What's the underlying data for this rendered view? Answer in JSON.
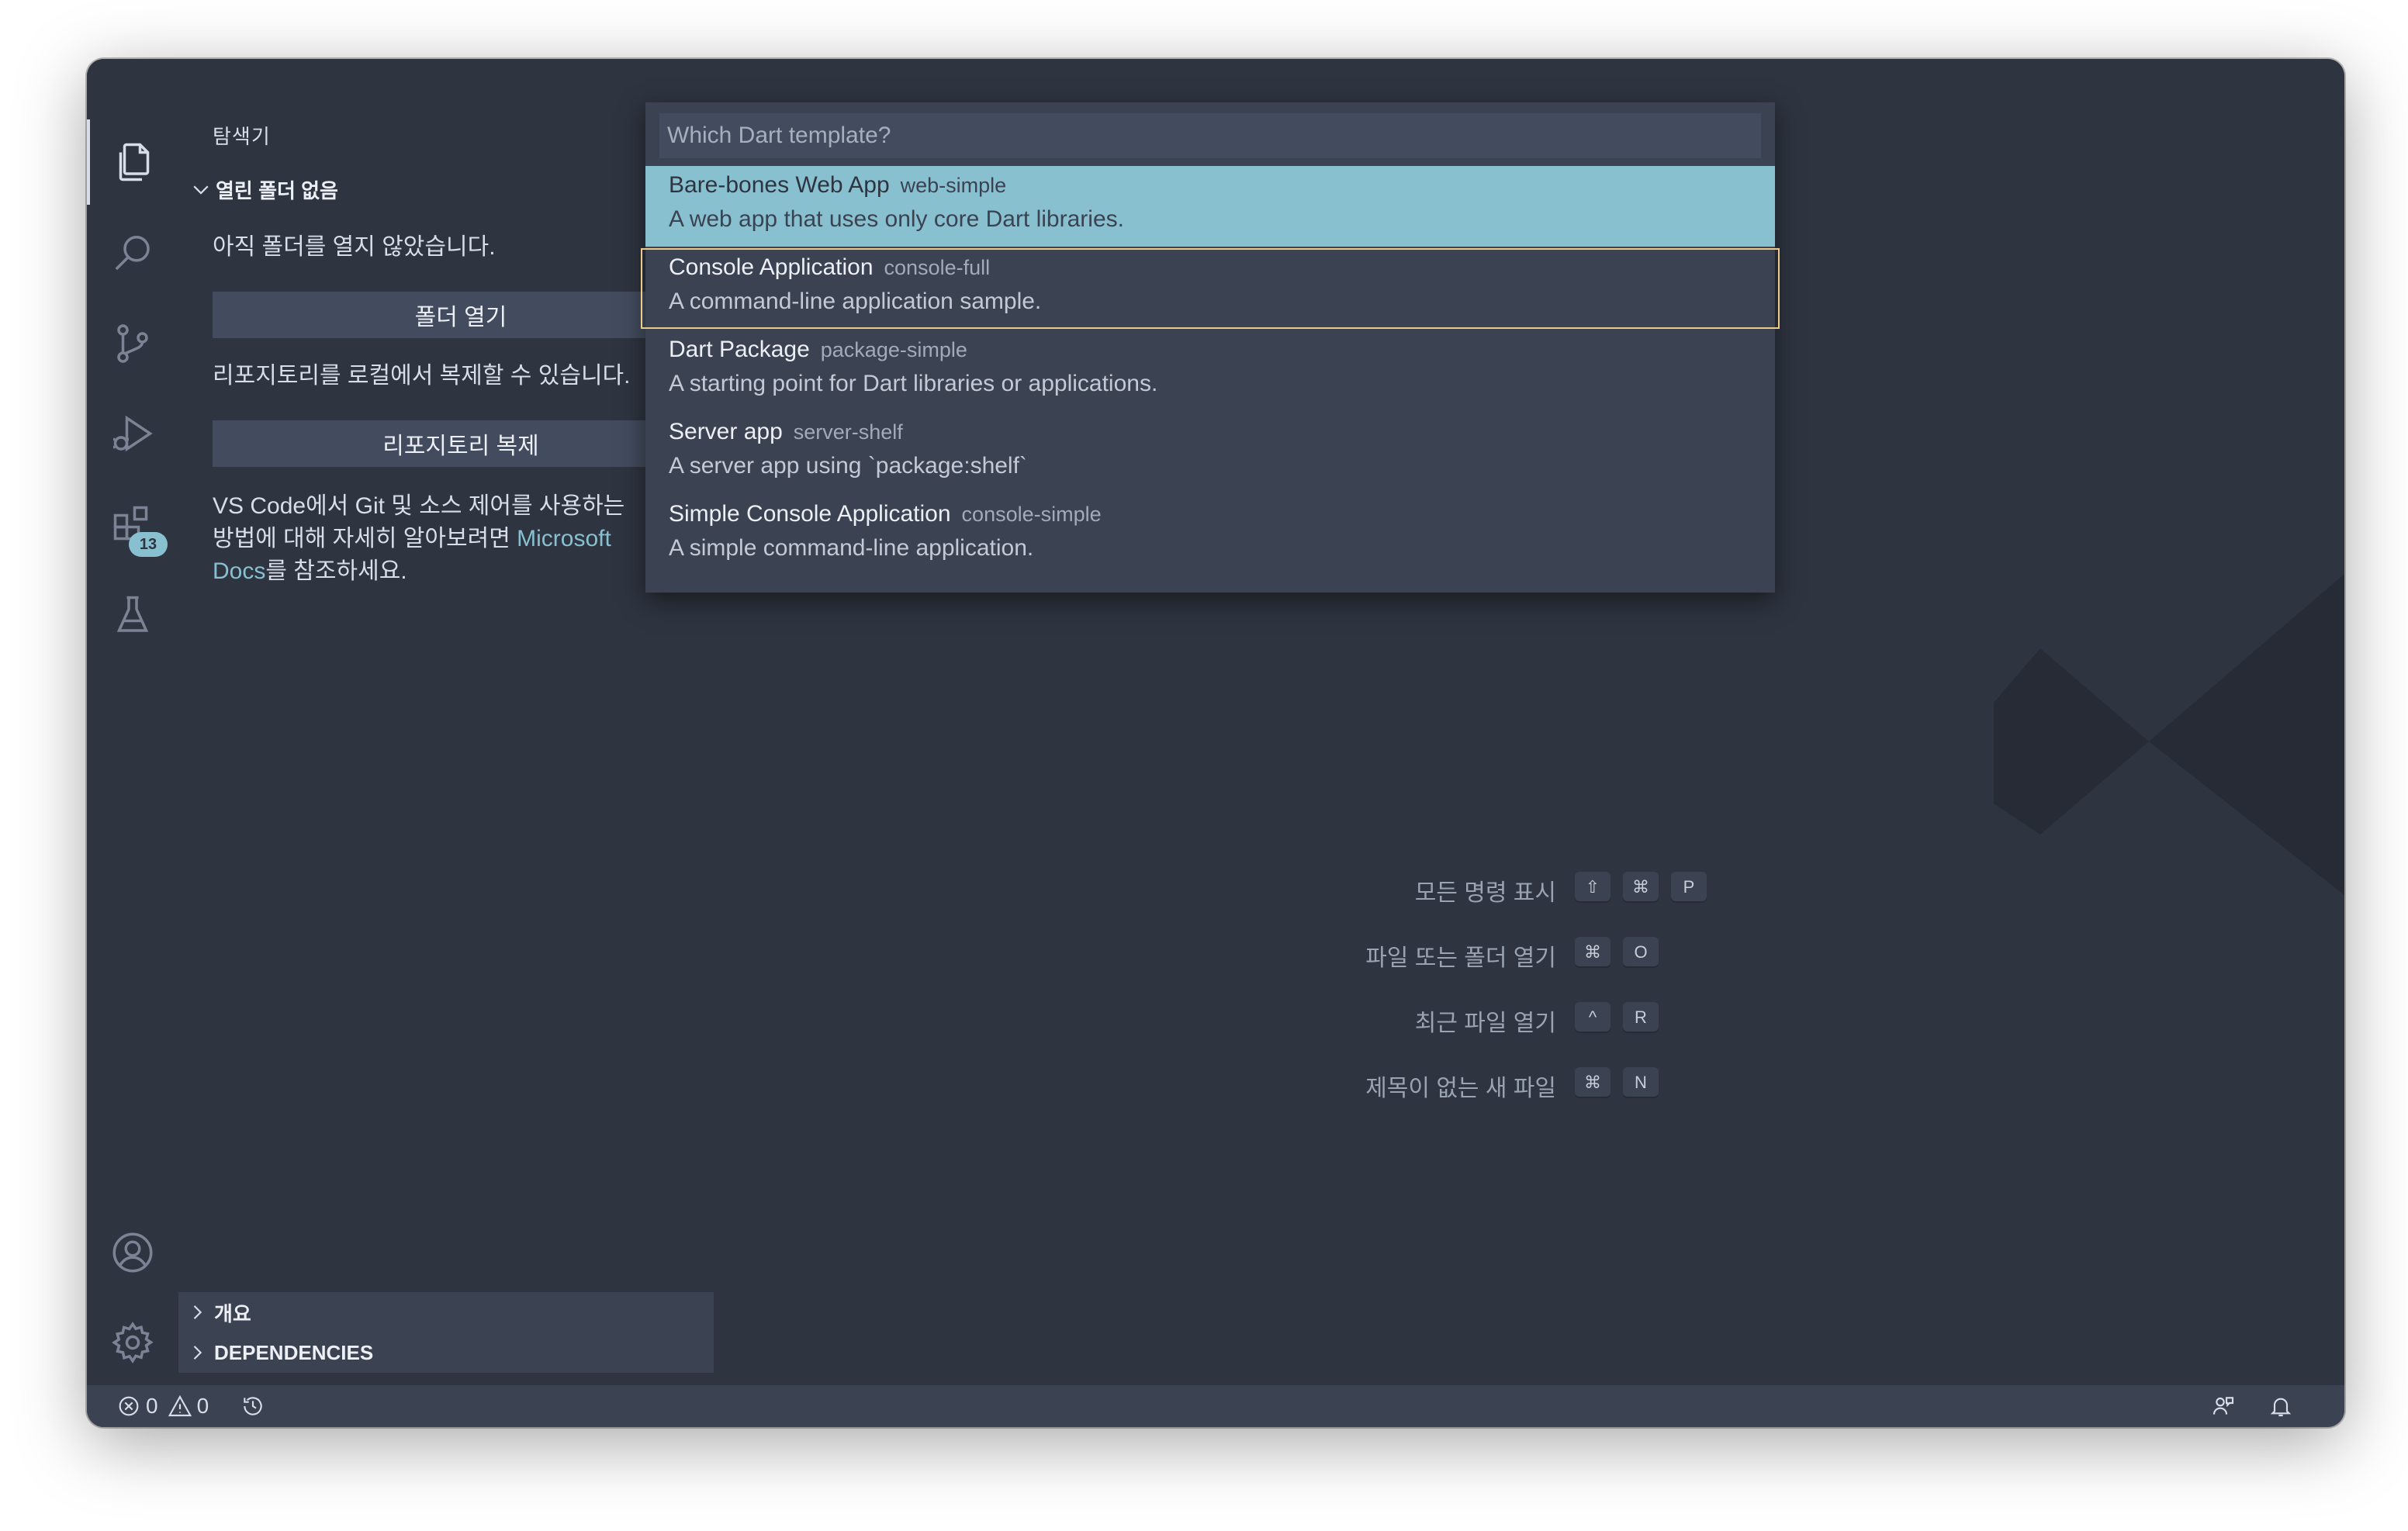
{
  "activity_bar": {
    "items": [
      {
        "name": "explorer",
        "icon": "files-icon",
        "active": true
      },
      {
        "name": "search",
        "icon": "search-icon"
      },
      {
        "name": "source-control",
        "icon": "source-control-icon"
      },
      {
        "name": "run-debug",
        "icon": "run-debug-icon"
      },
      {
        "name": "extensions",
        "icon": "extensions-icon",
        "badge": "13"
      },
      {
        "name": "testing",
        "icon": "flask-icon"
      }
    ],
    "bottom": [
      "account-icon",
      "gear-icon"
    ]
  },
  "sidebar": {
    "title": "탐색기",
    "section_title": "열린 폴더 없음",
    "no_folder_text": "아직 폴더를 열지 않았습니다.",
    "open_folder_button": "폴더 열기",
    "clone_text": "리포지토리를 로컬에서 복제할 수 있습니다.",
    "clone_button": "리포지토리 복제",
    "learn_text_1": "VS Code에서 Git 및 소스 제어를 사용하는",
    "learn_text_2": "방법에 대해 자세히 알아보려면 ",
    "learn_link_a": "Microsoft",
    "learn_link_b": "Docs",
    "learn_text_3": "를 참조하세요.",
    "outline_section": "개요",
    "dependencies_section": "DEPENDENCIES"
  },
  "quick_pick": {
    "placeholder": "Which Dart template?",
    "value": "",
    "items": [
      {
        "label": "Bare-bones Web App",
        "id": "web-simple",
        "detail": "A web app that uses only core Dart libraries.",
        "state": "selected"
      },
      {
        "label": "Console Application",
        "id": "console-full",
        "detail": "A command-line application sample.",
        "state": "focused"
      },
      {
        "label": "Dart Package",
        "id": "package-simple",
        "detail": "A starting point for Dart libraries or applications.",
        "state": ""
      },
      {
        "label": "Server app",
        "id": "server-shelf",
        "detail": "A server app using `package:shelf`",
        "state": ""
      },
      {
        "label": "Simple Console Application",
        "id": "console-simple",
        "detail": "A simple command-line application.",
        "state": ""
      }
    ]
  },
  "editor": {
    "shortcuts": [
      {
        "label": "모든 명령 표시",
        "keys": [
          "⇧",
          "⌘",
          "P"
        ]
      },
      {
        "label": "파일 또는 폴더 열기",
        "keys": [
          "⌘",
          "O"
        ]
      },
      {
        "label": "최근 파일 열기",
        "keys": [
          "^",
          "R"
        ]
      },
      {
        "label": "제목이 없는 새 파일",
        "keys": [
          "⌘",
          "N"
        ]
      }
    ]
  },
  "status_bar": {
    "errors": "0",
    "warnings": "0"
  },
  "colors": {
    "background": "#2e3440",
    "accent": "#88c0d0",
    "focus_border": "#ebcb8b"
  }
}
